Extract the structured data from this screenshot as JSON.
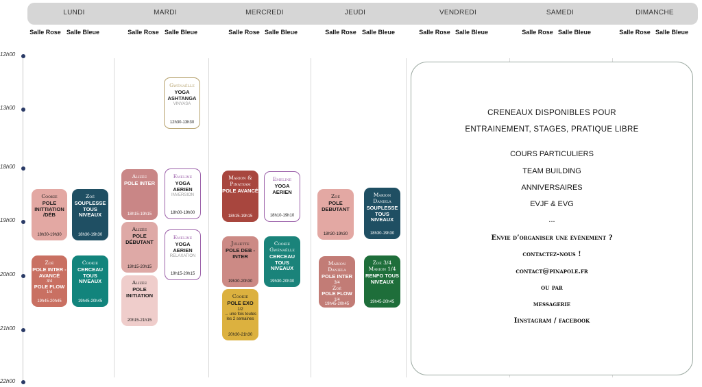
{
  "days": [
    "LUNDI",
    "MARDI",
    "MERCREDI",
    "JEUDI",
    "VENDREDI",
    "SAMEDI",
    "DIMANCHE"
  ],
  "rooms": {
    "rose": "Salle Rose",
    "bleue": "Salle Bleue"
  },
  "hours": [
    "12h00",
    "13h00",
    "18h00",
    "19h00",
    "20h00",
    "21h00",
    "22h00"
  ],
  "slots": [
    {
      "teacher": "Cookie",
      "title": "POLE INITTIATION /DÉB",
      "sub": "",
      "time": "18h30-19h30",
      "bg": "#e3a8a3",
      "fg": "#1a1a1a"
    },
    {
      "teacher": "Zoé",
      "title": "SOUPLESSE TOUS NIVEAUX",
      "sub": "",
      "time": "18h30-19h30",
      "bg": "#1f4f63",
      "fg": "#ffffff"
    },
    {
      "teacher": "Zoé",
      "title": "POLE INTER - AVANCÉ",
      "sub": "3/4",
      "title2": "POLE FLOW",
      "sub2": "1/4",
      "time": "19h45-20h45",
      "bg": "#c97062",
      "fg": "#ffffff"
    },
    {
      "teacher": "Cookie",
      "title": "CERCEAU TOUS NIVEAUX",
      "sub": "",
      "time": "19h45-20h45",
      "bg": "#12847c",
      "fg": "#ffffff"
    },
    {
      "teacher": "Gwénaëlle",
      "title": "YOGA ASHTANGA",
      "sub": "VINYASA",
      "time": "12h30-13h30",
      "bg": "#ffffff",
      "fg": "#1a1a1a",
      "border": "#b5a06b"
    },
    {
      "teacher": "Alizée",
      "title": "POLE INTER",
      "sub": "",
      "time": "18h15-19h15",
      "bg": "#c98686",
      "fg": "#ffffff"
    },
    {
      "teacher": "Emeline",
      "title": "YOGA AERIEN",
      "sub": "INVERSION",
      "time": "18h00-19h00",
      "bg": "#ffffff",
      "fg": "#1a1a1a",
      "border": "#9a5ea8"
    },
    {
      "teacher": "Alizée",
      "title": "POLE DÉBUTANT",
      "sub": "",
      "time": "19h15-20h15",
      "bg": "#dea9a6",
      "fg": "#1a1a1a"
    },
    {
      "teacher": "Emeline",
      "title": "YOGA AERIEN",
      "sub": "RELAXATION",
      "time": "19h15-20h15",
      "bg": "#ffffff",
      "fg": "#1a1a1a",
      "border": "#9a5ea8"
    },
    {
      "teacher": "Alizée",
      "title": "POLE INITIATION",
      "sub": "",
      "time": "20h15-21h15",
      "bg": "#efcdcb",
      "fg": "#1a1a1a"
    },
    {
      "teacher": "Marion & Pinateam",
      "title": "POLE AVANCÉ",
      "sub": "",
      "time": "18h15-19h15",
      "bg": "#a8463e",
      "fg": "#ffffff"
    },
    {
      "teacher": "Emeline",
      "title": "YOGA AERIEN",
      "sub": "",
      "time": "18h10-19h10",
      "bg": "#ffffff",
      "fg": "#1a1a1a",
      "border": "#9a5ea8"
    },
    {
      "teacher": "Juliette",
      "title": "POLE DEB - INTER",
      "sub": "",
      "time": "19h30-20h30",
      "bg": "#cc8a85",
      "fg": "#1a1a1a"
    },
    {
      "teacher": "Cookie Gwénaëlle",
      "title": "CERCEAU TOUS NIVEAUX",
      "sub": "",
      "time": "19h30-20h30",
      "bg": "#1a837a",
      "fg": "#ffffff"
    },
    {
      "teacher": "Cookie",
      "title": "POLE EXO",
      "sub": "1/2",
      "note": "→ une fois toutes les 2 semaines",
      "time": "20h30-21h30",
      "bg": "#dcb13f",
      "fg": "#1a1a1a"
    },
    {
      "teacher": "Zoé",
      "title": "POLE DEBUTANT",
      "sub": "",
      "time": "18h30-19h30",
      "bg": "#e3a8a3",
      "fg": "#1a1a1a"
    },
    {
      "teacher": "Marion Daniela",
      "title": "SOUPLESSE TOUS NIVEAUX",
      "sub": "",
      "time": "18h30-19h30",
      "bg": "#1f4f63",
      "fg": "#ffffff"
    },
    {
      "teacher": "Marion Daniela",
      "title": "POLE INTER",
      "sub": "3/4",
      "teacher2": "Zoé",
      "title2": "POLE FLOW",
      "sub2": "1/4",
      "time": "19h45-20h45",
      "bg": "#c27c76",
      "fg": "#ffffff"
    },
    {
      "teacher": "Zoé 3/4 Marion 1/4",
      "title": "RENFO TOUS NIVEAUX",
      "sub": "",
      "time": "19h45-20h45",
      "bg": "#1e6e3a",
      "fg": "#ffffff"
    }
  ],
  "info": {
    "line1": "CRENEAUX DISPONIBLES POUR",
    "line2": "ENTRAINEMENT,  STAGES, PRATIQUE LIBRE",
    "line3": "COURS PARTICULIERS",
    "line4": "TEAM BUILDING",
    "line5": "ANNIVERSAIRES",
    "line6": "EVJF & EVG",
    "line7": "...",
    "line8": "Envie d’organiser une évènement ?",
    "line9": "contactez-nous !",
    "line10": "contact@pinapole.fr",
    "line11": "ou par",
    "line12": "messagerie",
    "line13": "Iinstagram / facebook"
  }
}
